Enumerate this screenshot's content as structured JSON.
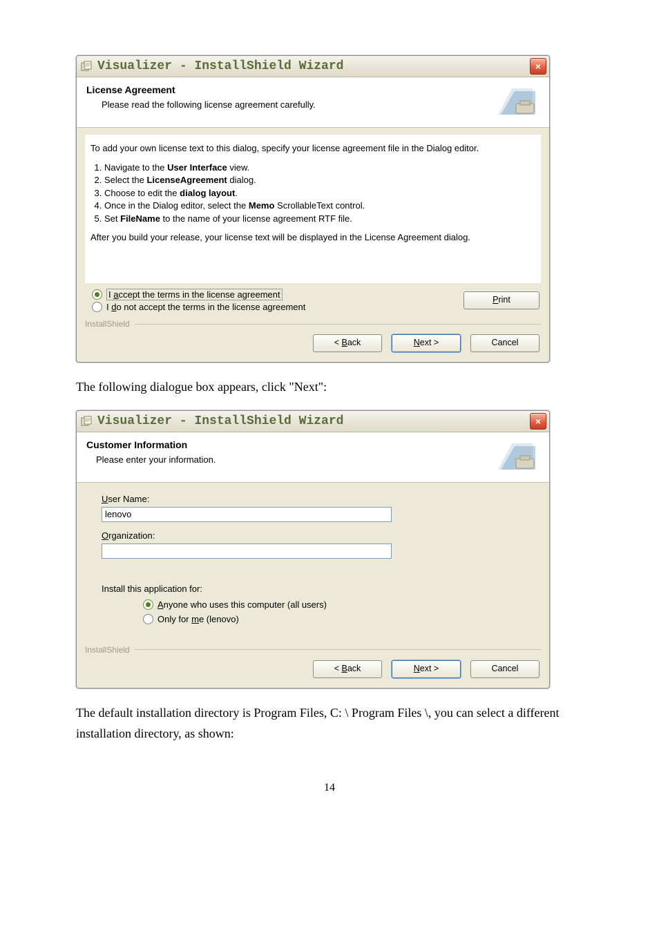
{
  "dialog1": {
    "title": "Visualizer - InstallShield Wizard",
    "close_glyph": "×",
    "header_title": "License Agreement",
    "header_sub": "Please read the following license agreement carefully.",
    "para1": "To add your own license text to this dialog, specify your license agreement file in the Dialog editor.",
    "steps": [
      "Navigate to the <b>User Interface</b> view.",
      "Select the <b>LicenseAgreement</b> dialog.",
      "Choose to edit the <b>dialog layout</b>.",
      "Once in the Dialog editor, select the <b>Memo</b> ScrollableText control.",
      "Set <b>FileName</b> to the name of your license agreement RTF file."
    ],
    "para2": "After you build your release, your license text will be displayed in the License Agreement dialog.",
    "accept": "I accept the terms in the license agreement",
    "reject": "I do not accept the terms in the license agreement",
    "print": "Print",
    "installshield": "InstallShield",
    "back": "< Back",
    "next": "Next >",
    "cancel": "Cancel"
  },
  "between_text": "The following dialogue box appears, click \"Next\":",
  "dialog2": {
    "title": "Visualizer - InstallShield Wizard",
    "close_glyph": "×",
    "header_title": "Customer Information",
    "header_sub": "Please enter your information.",
    "user_label": "User Name:",
    "user_value": "lenovo",
    "org_label": "Organization:",
    "org_value": "",
    "install_for": "Install this application for:",
    "opt_all": "Anyone who uses this computer (all users)",
    "opt_me": "Only for me (lenovo)",
    "installshield": "InstallShield",
    "back": "< Back",
    "next": "Next >",
    "cancel": "Cancel"
  },
  "after_text": "The default installation directory is Program Files, C: \\ Program Files \\, you can select a different installation directory, as shown:",
  "page_number": "14"
}
